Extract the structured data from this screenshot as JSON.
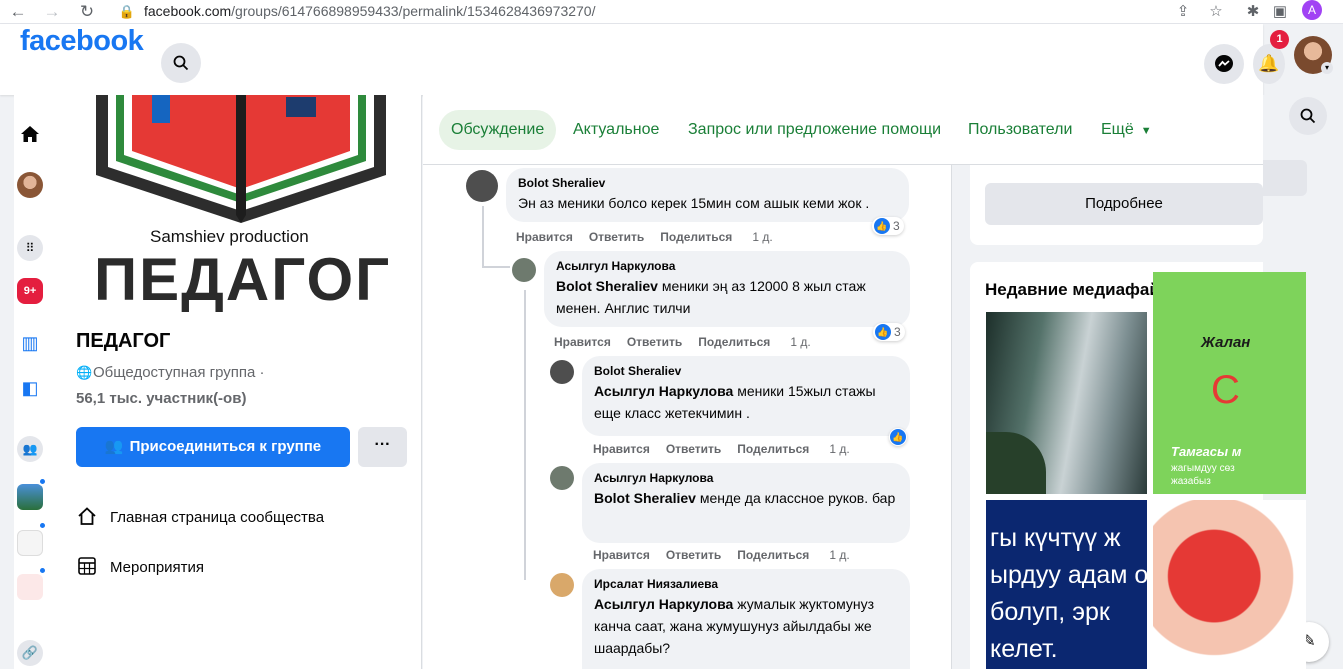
{
  "browser": {
    "url_host": "facebook.com",
    "url_path": "/groups/614766898959433/permalink/1534628436973270/",
    "profile_initial": "A"
  },
  "header": {
    "logo": "facebook",
    "notif_count": "1"
  },
  "rail": {
    "notif_badge": "9+"
  },
  "group": {
    "cover_brand": "Samshiev production",
    "cover_title": "ПЕДАГОГ",
    "name": "ПЕДАГОГ",
    "type": "Общедоступная группа ·",
    "members": "56,1 тыс. участник(-ов)",
    "join_label": "Присоединиться к группе",
    "more_label": "···",
    "links": [
      {
        "label": "Главная страница сообщества"
      },
      {
        "label": "Мероприятия"
      }
    ]
  },
  "tabs": [
    {
      "label": "Обсуждение"
    },
    {
      "label": "Актуальное"
    },
    {
      "label": "Запрос или предложение помощи"
    },
    {
      "label": "Пользователи"
    },
    {
      "label": "Ещё"
    }
  ],
  "comments": [
    {
      "author": "Bolot Sheraliev",
      "mention": "",
      "text": "Эн аз меники болсо керек 15мин сом ашык кеми жок .",
      "likes": "3",
      "time": "1 д."
    },
    {
      "author": "Асылгул Наркулова",
      "mention": "Bolot Sheraliev",
      "text": "меники эң аз 12000 8 жыл стаж менен. Англис тилчи",
      "likes": "3",
      "time": "1 д."
    },
    {
      "author": "Bolot Sheraliev",
      "mention": "Асылгул Наркулова",
      "text": "меники 15жыл стажы еще класс жетекчимин .",
      "likes": "",
      "time": "1 д."
    },
    {
      "author": "Асылгул Наркулова",
      "mention": "Bolot Sheraliev",
      "text": "менде да классное руков. бар",
      "likes": "",
      "time": "1 д."
    },
    {
      "author": "Ирсалат Ниязалиева",
      "mention": "Асылгул Наркулова",
      "text": "жумалык жуктомунуз канча саат, жана жумушунуз айылдабы же шаардабы?",
      "likes": "",
      "time": ""
    }
  ],
  "actions": {
    "like": "Нравится",
    "reply": "Ответить",
    "share": "Поделиться"
  },
  "right": {
    "more_info": "Подробнее",
    "media_title": "Недавние медиафайлы",
    "tile2_text1": "Жалан",
    "tile2_text2": "С",
    "tile2_text3": "Тамгасы м",
    "tile2_text4": "жагымдуу сөз",
    "tile2_text5": "жазабыз",
    "tile3_text": "гы күчтүү ж ырдуу адам о болуп, эрк келет."
  },
  "colors": {
    "brand": "#1877f2",
    "tab_green": "#1a7f37"
  }
}
